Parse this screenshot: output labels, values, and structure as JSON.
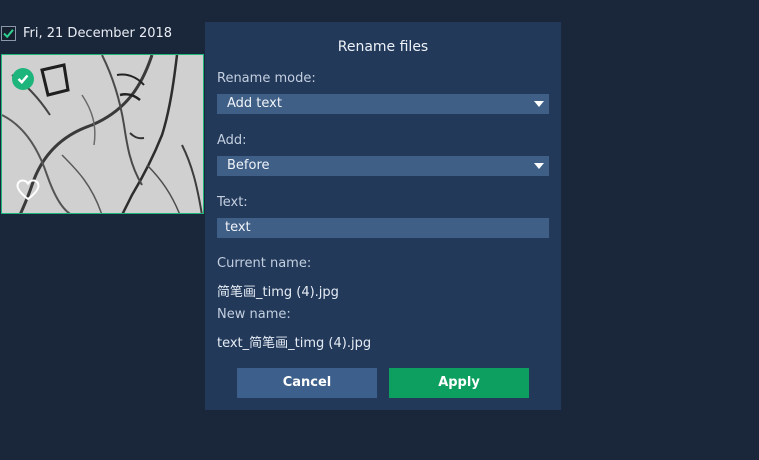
{
  "gallery": {
    "date_label": "Fri, 21 December 2018",
    "date_checked": true,
    "thumbnail": {
      "selected": true,
      "favorite": false
    }
  },
  "dialog": {
    "title": "Rename files",
    "rename_mode": {
      "label": "Rename mode:",
      "value": "Add text"
    },
    "add": {
      "label": "Add:",
      "value": "Before"
    },
    "text": {
      "label": "Text:",
      "value": "text"
    },
    "current_name": {
      "label": "Current name:",
      "value": "简笔画_timg (4).jpg"
    },
    "new_name": {
      "label": "New name:",
      "value": "text_简笔画_timg (4).jpg"
    },
    "buttons": {
      "cancel": "Cancel",
      "apply": "Apply"
    }
  },
  "colors": {
    "background": "#1a263a",
    "dialog": "#22395a",
    "field": "#3f5f87",
    "cancel": "#3d5f8b",
    "apply": "#0d9f5f",
    "selected_accent": "#1db57c"
  }
}
